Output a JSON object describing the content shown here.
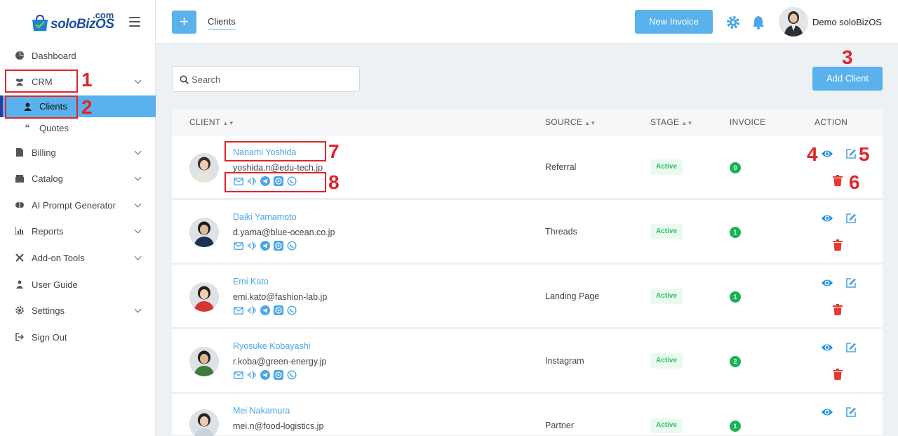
{
  "app": {
    "brand": "soloBizOS",
    "brand_suffix": ".com"
  },
  "sidebar": {
    "items": [
      {
        "label": "Dashboard",
        "icon": "pie-icon"
      },
      {
        "label": "CRM",
        "icon": "users-icon"
      },
      {
        "label": "Clients",
        "icon": "user-icon"
      },
      {
        "label": "Quotes",
        "icon": "quote-icon"
      },
      {
        "label": "Billing",
        "icon": "file-icon"
      },
      {
        "label": "Catalog",
        "icon": "box-icon"
      },
      {
        "label": "AI Prompt Generator",
        "icon": "brain-icon"
      },
      {
        "label": "Reports",
        "icon": "chart-icon"
      },
      {
        "label": "Add-on Tools",
        "icon": "tools-icon"
      },
      {
        "label": "User Guide",
        "icon": "guide-icon"
      },
      {
        "label": "Settings",
        "icon": "gear-icon"
      },
      {
        "label": "Sign Out",
        "icon": "signout-icon"
      }
    ]
  },
  "topbar": {
    "tab": "Clients",
    "new_invoice": "New Invoice",
    "user_name": "Demo soloBizOS"
  },
  "search": {
    "placeholder": "Search"
  },
  "add_client": "Add Client",
  "table": {
    "headers": {
      "client": "CLIENT",
      "source": "SOURCE",
      "stage": "STAGE",
      "invoice": "INVOICE",
      "action": "ACTION"
    },
    "rows": [
      {
        "name": "Nanami Yoshida",
        "email": "yoshida.n@edu-tech.jp",
        "source": "Referral",
        "stage": "Active",
        "invoice": "0",
        "invoice_color": "#19b25a"
      },
      {
        "name": "Daiki Yamamoto",
        "email": "d.yama@blue-ocean.co.jp",
        "source": "Threads",
        "stage": "Active",
        "invoice": "1",
        "invoice_color": "#19b25a"
      },
      {
        "name": "Emi Kato",
        "email": "emi.kato@fashion-lab.jp",
        "source": "Landing Page",
        "stage": "Active",
        "invoice": "1",
        "invoice_color": "#19b25a"
      },
      {
        "name": "Ryosuke Kobayashi",
        "email": "r.koba@green-energy.jp",
        "source": "Instagram",
        "stage": "Active",
        "invoice": "2",
        "invoice_color": "#19b25a"
      },
      {
        "name": "Mei Nakamura",
        "email": "mei.n@food-logistics.jp",
        "source": "Partner",
        "stage": "Active",
        "invoice": "1",
        "invoice_color": "#19b25a"
      }
    ]
  },
  "annotations": [
    "1",
    "2",
    "3",
    "4",
    "5",
    "6",
    "7",
    "8"
  ],
  "colors": {
    "accent": "#5ab2ec",
    "link": "#4aa6e6",
    "active_stage_text": "#2ec26b",
    "delete": "#e53935",
    "annotation": "#e0242c"
  }
}
